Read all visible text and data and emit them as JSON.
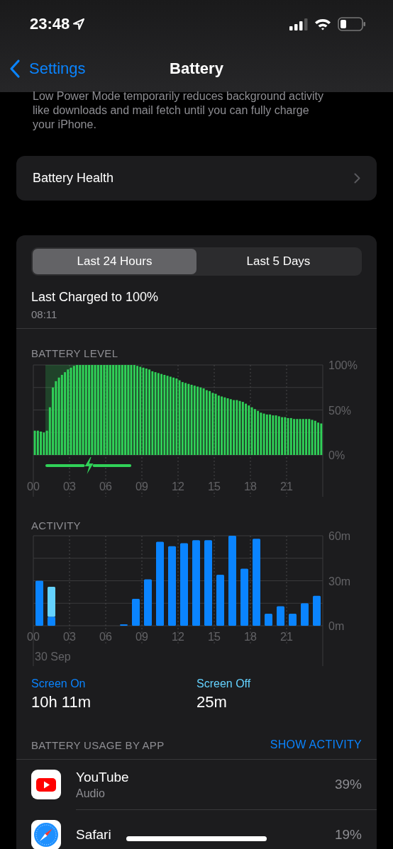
{
  "status_bar": {
    "time": "23:48"
  },
  "nav": {
    "back": "Settings",
    "title": "Battery"
  },
  "note": "Low Power Mode temporarily reduces background activity like downloads and mail fetch until you can fully charge your iPhone.",
  "health": {
    "label": "Battery Health"
  },
  "tabs": [
    {
      "label": "Last 24 Hours",
      "selected": true
    },
    {
      "label": "Last 5 Days",
      "selected": false
    }
  ],
  "last_charged": {
    "title": "Last Charged to 100%",
    "time": "08:11"
  },
  "battery_level": {
    "chart_data": {
      "type": "bar",
      "title": "BATTERY LEVEL",
      "x": [
        0.125,
        0.375,
        0.625,
        0.875,
        1.125,
        1.375,
        1.625,
        1.875,
        2.125,
        2.375,
        2.625,
        2.875,
        3.125,
        3.375,
        3.625,
        3.875,
        4.125,
        4.375,
        4.625,
        4.875,
        5.125,
        5.375,
        5.625,
        5.875,
        6.125,
        6.375,
        6.625,
        6.875,
        7.125,
        7.375,
        7.625,
        7.875,
        8.125,
        8.375,
        8.625,
        8.875,
        9.125,
        9.375,
        9.625,
        9.875,
        10.125,
        10.375,
        10.625,
        10.875,
        11.125,
        11.375,
        11.625,
        11.875,
        12.125,
        12.375,
        12.625,
        12.875,
        13.125,
        13.375,
        13.625,
        13.875,
        14.125,
        14.375,
        14.625,
        14.875,
        15.125,
        15.375,
        15.625,
        15.875,
        16.125,
        16.375,
        16.625,
        16.875,
        17.125,
        17.375,
        17.625,
        17.875,
        18.125,
        18.375,
        18.625,
        18.875,
        19.125,
        19.375,
        19.625,
        19.875,
        20.125,
        20.375,
        20.625,
        20.875,
        21.125,
        21.375,
        21.625,
        21.875,
        22.125,
        22.375,
        22.625,
        22.875,
        23.125,
        23.375,
        23.625,
        23.875
      ],
      "values": [
        27,
        27,
        26,
        25,
        27,
        53,
        75,
        82,
        86,
        89,
        92,
        95,
        97,
        99,
        100,
        100,
        100,
        100,
        100,
        100,
        100,
        100,
        100,
        100,
        100,
        100,
        100,
        100,
        100,
        100,
        100,
        100,
        100,
        100,
        99,
        98,
        97,
        96,
        95,
        93,
        92,
        91,
        90,
        89,
        88,
        87,
        86,
        85,
        83,
        81,
        80,
        79,
        78,
        77,
        76,
        75,
        74,
        72,
        71,
        69,
        68,
        66,
        65,
        64,
        63,
        62,
        61,
        61,
        60,
        59,
        57,
        55,
        53,
        51,
        49,
        47,
        46,
        45,
        45,
        44,
        44,
        43,
        42,
        42,
        41,
        41,
        40,
        40,
        40,
        40,
        40,
        40,
        39,
        38,
        36,
        35
      ],
      "xlim": [
        0,
        24
      ],
      "ylim": [
        0,
        100
      ],
      "yticks": [
        {
          "value": 0,
          "label": "0%"
        },
        {
          "value": 50,
          "label": "50%"
        },
        {
          "value": 100,
          "label": "100%"
        }
      ],
      "xticks": [
        {
          "value": 0,
          "label": "00"
        },
        {
          "value": 3,
          "label": "03"
        },
        {
          "value": 6,
          "label": "06"
        },
        {
          "value": 9,
          "label": "09"
        },
        {
          "value": 12,
          "label": "12"
        },
        {
          "value": 15,
          "label": "15"
        },
        {
          "value": 18,
          "label": "18"
        },
        {
          "value": 21,
          "label": "21"
        }
      ],
      "bands": [
        {
          "axis": "x",
          "from": 1,
          "to": 8.125
        }
      ],
      "grid": true
    }
  },
  "activity": {
    "chart_data": {
      "type": "bar",
      "title": "ACTIVITY",
      "stacked": true,
      "x": [
        0.5,
        1.5,
        2.5,
        3.5,
        4.5,
        5.5,
        6.5,
        7.5,
        8.5,
        9.5,
        10.5,
        11.5,
        12.5,
        13.5,
        14.5,
        15.5,
        16.5,
        17.5,
        18.5,
        19.5,
        20.5,
        21.5,
        22.5,
        23.5
      ],
      "series": [
        {
          "name": "Screen On",
          "color": "#0a84ff",
          "values": [
            30,
            6,
            0,
            0,
            0,
            0,
            0,
            1,
            18,
            31,
            56,
            53,
            55,
            57,
            57,
            34,
            60,
            38,
            58,
            8,
            13,
            8,
            15,
            20
          ]
        },
        {
          "name": "Screen Off",
          "color": "#64d2ff",
          "values": [
            0,
            20,
            0,
            0,
            0,
            0,
            0,
            0,
            0,
            0,
            0,
            0,
            0,
            0,
            0,
            0,
            0,
            0,
            0,
            0,
            0,
            0,
            0,
            0
          ]
        }
      ],
      "xlim": [
        0,
        24
      ],
      "ylim": [
        0,
        60
      ],
      "yticks": [
        {
          "value": 0,
          "label": "0m"
        },
        {
          "value": 30,
          "label": "30m"
        },
        {
          "value": 60,
          "label": "60m"
        }
      ],
      "grid": true,
      "xticks": [
        {
          "value": 0,
          "label": "00"
        },
        {
          "value": 3,
          "label": "03"
        },
        {
          "value": 6,
          "label": "06"
        },
        {
          "value": 9,
          "label": "09"
        },
        {
          "value": 12,
          "label": "12"
        },
        {
          "value": 15,
          "label": "15"
        },
        {
          "value": 18,
          "label": "18"
        },
        {
          "value": 21,
          "label": "21"
        }
      ]
    },
    "date": "30 Sep"
  },
  "totals": [
    {
      "value": "10h 11m"
    },
    {
      "value": "25m"
    }
  ],
  "usage": {
    "title": "BATTERY USAGE BY APP",
    "action": "SHOW ACTIVITY",
    "apps": [
      {
        "name": "YouTube",
        "detail": "Audio",
        "percent": "39%",
        "kind": "youtube"
      },
      {
        "name": "Safari",
        "percent": "19%",
        "kind": "safari"
      }
    ]
  }
}
